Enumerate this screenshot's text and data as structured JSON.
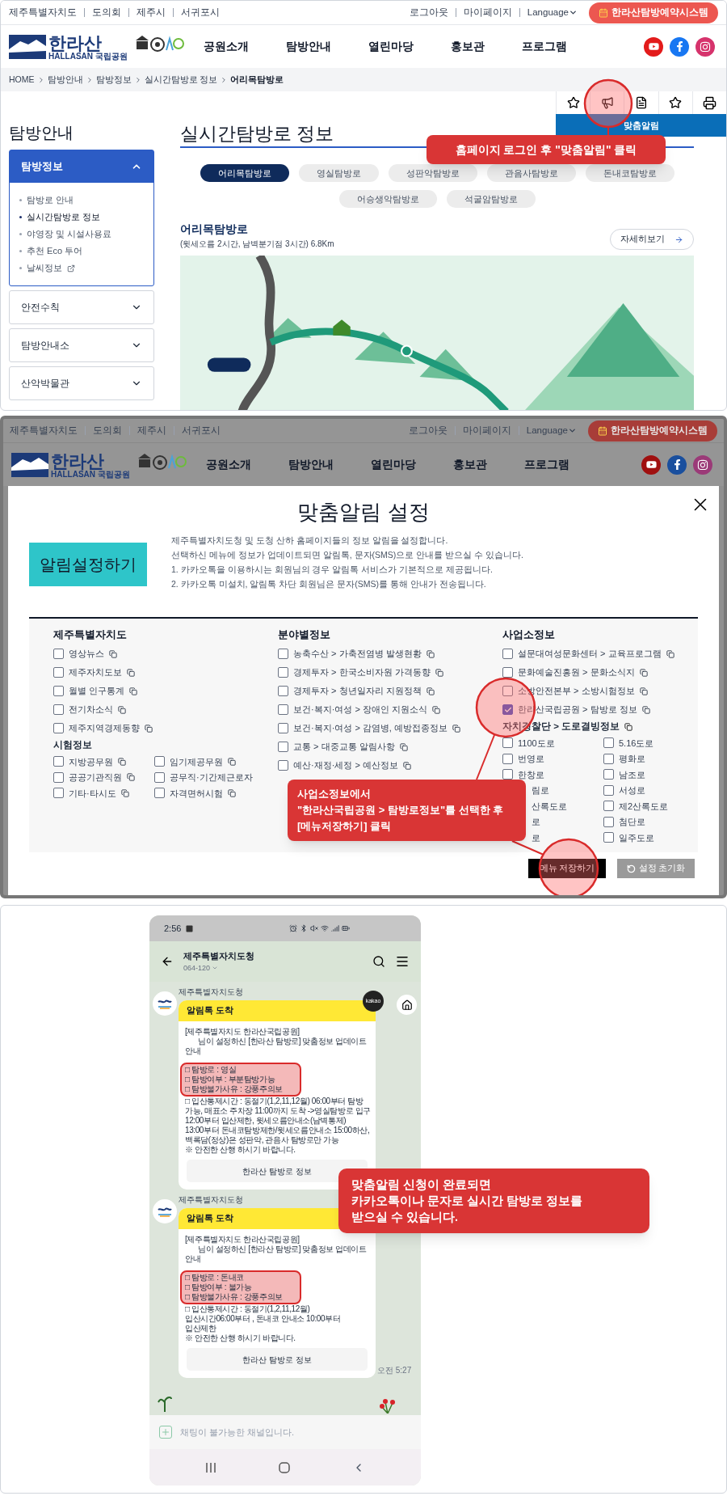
{
  "step1": {
    "header": {
      "site_links": [
        "제주특별자치도",
        "도의회",
        "제주시",
        "서귀포시"
      ],
      "account_links": [
        "로그아웃",
        "마이페이지"
      ],
      "language": "Language",
      "reserve_button": "한라산탐방예약시스템",
      "logo_title": "한라산",
      "logo_subtitle": "HALLASAN 국립공원",
      "nav": [
        "공원소개",
        "탐방안내",
        "열린마당",
        "홍보관",
        "프로그램"
      ]
    },
    "breadcrumb": [
      "HOME",
      "탐방안내",
      "탐방정보",
      "실시간탐방로 정보",
      "어리목탐방로"
    ],
    "tool_tab": "맞춤알림",
    "callout": "홈페이지 로그인 후 \"맞춤알림\" 클릭",
    "sidebar": {
      "title": "탐방안내",
      "sections": [
        {
          "title": "탐방정보",
          "expanded": true,
          "items": [
            {
              "label": "탐방로 안내",
              "selected": false,
              "external": false
            },
            {
              "label": "실시간탐방로 정보",
              "selected": true,
              "external": false
            },
            {
              "label": "야영장 및 시설사용료",
              "selected": false,
              "external": false
            },
            {
              "label": "추천 Eco 투어",
              "selected": false,
              "external": false
            },
            {
              "label": "날씨정보",
              "selected": false,
              "external": true
            }
          ]
        },
        {
          "title": "안전수칙",
          "expanded": false
        },
        {
          "title": "탐방안내소",
          "expanded": false
        },
        {
          "title": "산악박물관",
          "expanded": false
        }
      ]
    },
    "page_title": "실시간탐방로 정보",
    "tabs": [
      {
        "label": "어리목탐방로",
        "selected": true
      },
      {
        "label": "영실탐방로",
        "selected": false
      },
      {
        "label": "성판악탐방로",
        "selected": false
      },
      {
        "label": "관음사탐방로",
        "selected": false
      },
      {
        "label": "돈내코탐방로",
        "selected": false
      },
      {
        "label": "어승생악탐방로",
        "selected": false
      },
      {
        "label": "석굴암탐방로",
        "selected": false
      }
    ],
    "trail": {
      "name": "어리목탐방로",
      "summary": "(윗세오름 2시간, 남벽분기점 3시간) 6.8Km",
      "more_button": "자세히보기"
    }
  },
  "step2": {
    "header": {
      "site_links": [
        "제주특별자치도",
        "도의회",
        "제주시",
        "서귀포시"
      ],
      "account_links": [
        "로그아웃",
        "마이페이지"
      ],
      "language": "Language",
      "reserve_button": "한라산탐방예약시스템",
      "logo_title": "한라산",
      "logo_subtitle": "HALLASAN 국립공원",
      "nav": [
        "공원소개",
        "탐방안내",
        "열린마당",
        "홍보관",
        "프로그램"
      ]
    },
    "modal": {
      "title": "맞춤알림 설정",
      "badge": "알림설정하기",
      "description": [
        "제주특별자치도청 및 도청 산하 홈페이지들의 정보 알림을 설정합니다.",
        "선택하신 메뉴에 정보가 업데이트되면 알림톡, 문자(SMS)으로 안내를 받으실 수 있습니다.",
        "1. 카카오톡을 이용하시는 회원님의 경우 알림톡 서비스가 기본적으로 제공됩니다.",
        "2. 카카오톡 미설치, 알림톡 차단 회원님은 문자(SMS)를 통해 안내가 전송됩니다."
      ],
      "columns": [
        {
          "title": "제주특별자치도",
          "items": [
            {
              "label": "영상뉴스",
              "checked": false
            },
            {
              "label": "제주자치도보",
              "checked": false
            },
            {
              "label": "월별 인구통계",
              "checked": false
            },
            {
              "label": "전기차소식",
              "checked": false
            },
            {
              "label": "제주지역경제동향",
              "checked": false
            }
          ],
          "subsections": [
            {
              "title": "시험정보",
              "title_icon": false,
              "item_icons": true,
              "items": [
                {
                  "label": "지방공무원",
                  "checked": false
                },
                {
                  "label": "임기제공무원",
                  "checked": false
                },
                {
                  "label": "공공기관직원",
                  "checked": false
                },
                {
                  "label": "공무직·기간제근로자",
                  "checked": false
                },
                {
                  "label": "기타·타시도",
                  "checked": false
                },
                {
                  "label": "자격면허시험",
                  "checked": false
                }
              ]
            }
          ]
        },
        {
          "title": "분야별정보",
          "items": [
            {
              "label": "농축수산 > 가축전염병 발생현황",
              "checked": false
            },
            {
              "label": "경제투자 > 한국소비자원 가격동향",
              "checked": false
            },
            {
              "label": "경제투자 > 청년일자리 지원정책",
              "checked": false
            },
            {
              "label": "보건·복지·여성 > 장애인 지원소식",
              "checked": false
            },
            {
              "label": "보건·복지·여성 > 감염병, 예방접종정보",
              "checked": false
            },
            {
              "label": "교통 > 대중교통 알림사항",
              "checked": false
            },
            {
              "label": "예산·재정·세정 > 예산정보",
              "checked": false
            }
          ]
        },
        {
          "title": "사업소정보",
          "items": [
            {
              "label": "설문대여성문화센터 > 교육프로그램",
              "checked": false
            },
            {
              "label": "문화예술진흥원 > 문화소식지",
              "checked": false
            },
            {
              "label": "소방안전본부 > 소방시험정보",
              "checked": false
            },
            {
              "label": "한라산국립공원 > 탐방로 정보",
              "checked": true
            }
          ],
          "subsections": [
            {
              "title": "자치경찰단 > 도로결빙정보",
              "title_icon": true,
              "item_icons": false,
              "items": [
                {
                  "label": "1100도로",
                  "checked": false
                },
                {
                  "label": "5.16도로",
                  "checked": false
                },
                {
                  "label": "번영로",
                  "checked": false
                },
                {
                  "label": "평화로",
                  "checked": false
                },
                {
                  "label": "한창로",
                  "checked": false
                },
                {
                  "label": "남조로",
                  "checked": false
                },
                {
                  "label": "림로",
                  "covered": true
                },
                {
                  "label": "서성로",
                  "checked": false
                },
                {
                  "label": "산록도로",
                  "covered": true
                },
                {
                  "label": "제2산록도로",
                  "checked": false
                },
                {
                  "label": "로",
                  "covered": true
                },
                {
                  "label": "첨단로",
                  "checked": false
                },
                {
                  "label": "로",
                  "covered": true
                },
                {
                  "label": "일주도로",
                  "checked": false
                }
              ]
            }
          ]
        }
      ],
      "save_button": "메뉴 저장하기",
      "reset_button": "설정 초기화"
    },
    "callout": "사업소정보에서\n\"한라산국립공원 > 탐방로정보\"를 선택한 후\n[메뉴저장하기] 클릭"
  },
  "step3": {
    "phone": {
      "time": "2:56",
      "chat_title": "제주특별자치도청",
      "chat_subtitle": "064-120",
      "messages": [
        {
          "sender": "제주특별자치도청",
          "badge": "kakao",
          "header": "알림톡 도착",
          "intro": [
            {
              "text": "[제주특별자치도 한라산국립공원]",
              "indented": false
            },
            {
              "text": "님이 설정하신 [한라산 탐방로] 맞춤정보 업데이트",
              "indented": true
            },
            {
              "text": "안내",
              "indented": false
            }
          ],
          "highlight": [
            "□ 탐방로 : 영실",
            "□ 탐방여부 : 부분탐방가능",
            "□ 탐방불가사유 : 강풍주의보"
          ],
          "body": [
            "□ 입산통제시간 : 동절기(1,2,11,12월) 06:00부터 탐방",
            "가능, 매표소 주차장 11:00까지 도착 ->영실탐방로 입구",
            "12:00부터 입산제한, 윗세오름안내소(남벽통제)",
            "13:00부터 돈내코탐방제한/윗세오름안내소 15:00하산,",
            "백록담(정상)은 성판악, 관음사 탐방로만 가능",
            "※ 안전한 산행 하시기 바랍니다."
          ],
          "button": "한라산 탐방로 정보"
        },
        {
          "sender": "제주특별자치도청",
          "header": "알림톡 도착",
          "intro": [
            {
              "text": "[제주특별자치도 한라산국립공원]",
              "indented": false
            },
            {
              "text": "님이 설정하신 [한라산 탐방로] 맞춤정보 업데이트",
              "indented": true
            },
            {
              "text": "안내",
              "indented": false
            }
          ],
          "highlight": [
            "□ 탐방로 : 돈내코",
            "□ 탐방여부 : 불가능",
            "□ 탐방불가사유 : 강풍주의보"
          ],
          "body": [
            "□ 입산통제시간 : 동절기(1,2,11,12월)",
            "입산시간06:00부터 , 돈내코 안내소 10:00부터",
            "입산제한",
            "※ 안전한 산행 하시기 바랍니다."
          ],
          "button": "한라산 탐방로 정보",
          "time": "오전 5:27"
        }
      ],
      "input": {
        "placeholder": "채팅이 불가능한 채널입니다."
      }
    },
    "callout": "맞춤알림 신청이 완료되면\n카카오톡이나 문자로 실시간 탐방로 정보를\n받으실 수 있습니다."
  }
}
